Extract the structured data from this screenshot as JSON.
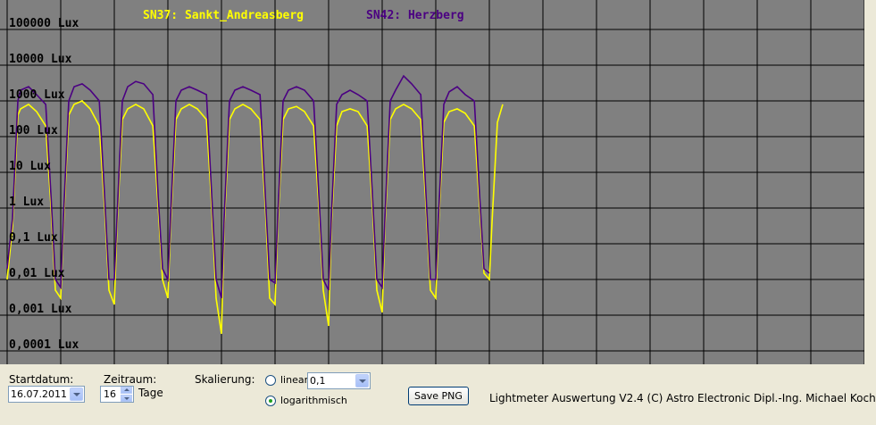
{
  "chart_data": {
    "type": "line",
    "title": "",
    "xlabel": "",
    "ylabel": "",
    "y_scale": "log",
    "ylim": [
      0.0001,
      100000
    ],
    "xlim": [
      0,
      16
    ],
    "x_unit": "days from 16.07.2011",
    "grid": true,
    "y_tick_labels": [
      "100000 Lux",
      "10000 Lux",
      "1000 Lux",
      "100 Lux",
      "10 Lux",
      "1 Lux",
      "0,1 Lux",
      "0,01 Lux",
      "0,001 Lux",
      "0,0001 Lux"
    ],
    "series": [
      {
        "name": "SN37: Sankt_Andreasberg",
        "color": "#ffff00",
        "x": [
          0.0,
          0.1,
          0.2,
          0.25,
          0.4,
          0.55,
          0.72,
          0.82,
          0.9,
          1.0,
          1.05,
          1.15,
          1.25,
          1.4,
          1.55,
          1.72,
          1.82,
          1.9,
          2.0,
          2.05,
          2.15,
          2.25,
          2.4,
          2.55,
          2.72,
          2.82,
          2.9,
          3.0,
          3.05,
          3.15,
          3.25,
          3.4,
          3.55,
          3.72,
          3.82,
          3.9,
          4.0,
          4.05,
          4.15,
          4.25,
          4.4,
          4.55,
          4.72,
          4.82,
          4.9,
          5.0,
          5.05,
          5.15,
          5.25,
          5.4,
          5.55,
          5.72,
          5.82,
          5.9,
          6.0,
          6.05,
          6.15,
          6.25,
          6.4,
          6.55,
          6.72,
          6.82,
          6.9,
          7.0,
          7.05,
          7.15,
          7.25,
          7.4,
          7.55,
          7.72,
          7.82,
          7.9,
          8.0,
          8.05,
          8.15,
          8.25,
          8.4,
          8.55,
          8.72,
          8.82,
          8.9,
          9.0,
          9.05,
          9.15,
          9.25
        ],
        "y": [
          0.01,
          0.3,
          400,
          600,
          800,
          500,
          200,
          1,
          0.005,
          0.003,
          0.3,
          400,
          800,
          1000,
          600,
          200,
          1,
          0.005,
          0.002,
          0.3,
          300,
          600,
          800,
          600,
          200,
          1,
          0.01,
          0.003,
          0.3,
          300,
          600,
          800,
          600,
          300,
          1,
          0.003,
          0.0003,
          0.3,
          300,
          600,
          800,
          600,
          300,
          1,
          0.003,
          0.002,
          0.3,
          300,
          600,
          700,
          500,
          200,
          1,
          0.005,
          0.0005,
          0.3,
          200,
          500,
          600,
          500,
          200,
          1,
          0.005,
          0.0012,
          0.3,
          300,
          600,
          800,
          600,
          300,
          1,
          0.005,
          0.003,
          0.3,
          250,
          500,
          600,
          450,
          200,
          1,
          0.015,
          0.01,
          0.4,
          250,
          800
        ]
      },
      {
        "name": "SN42: Herzberg",
        "color": "#4b0082",
        "x": [
          0.0,
          0.1,
          0.2,
          0.25,
          0.4,
          0.55,
          0.72,
          0.82,
          0.9,
          1.0,
          1.05,
          1.15,
          1.25,
          1.4,
          1.55,
          1.72,
          1.82,
          1.9,
          2.0,
          2.05,
          2.15,
          2.25,
          2.4,
          2.55,
          2.72,
          2.82,
          2.9,
          3.0,
          3.05,
          3.15,
          3.25,
          3.4,
          3.55,
          3.72,
          3.82,
          3.9,
          4.0,
          4.05,
          4.15,
          4.25,
          4.4,
          4.55,
          4.72,
          4.82,
          4.9,
          5.0,
          5.05,
          5.15,
          5.25,
          5.4,
          5.55,
          5.72,
          5.82,
          5.9,
          6.0,
          6.05,
          6.15,
          6.25,
          6.4,
          6.55,
          6.72,
          6.82,
          6.9,
          7.0,
          7.05,
          7.15,
          7.25,
          7.4,
          7.55,
          7.72,
          7.82,
          7.9,
          8.0,
          8.05,
          8.15,
          8.25,
          8.4,
          8.55,
          8.72,
          8.82,
          8.9,
          9.0
        ],
        "y": [
          0.02,
          0.5,
          1000,
          2000,
          2500,
          1500,
          800,
          2,
          0.01,
          0.006,
          0.5,
          1000,
          2500,
          3000,
          2000,
          1000,
          2,
          0.01,
          0.01,
          0.5,
          1000,
          2500,
          3500,
          3000,
          1500,
          2,
          0.02,
          0.01,
          0.5,
          1000,
          2000,
          2500,
          2000,
          1500,
          2,
          0.01,
          0.003,
          0.5,
          1000,
          2000,
          2500,
          2000,
          1500,
          2,
          0.01,
          0.008,
          0.5,
          1000,
          2000,
          2500,
          2000,
          1000,
          2,
          0.01,
          0.005,
          0.5,
          800,
          1500,
          2000,
          1500,
          1000,
          2,
          0.01,
          0.006,
          0.5,
          1000,
          2000,
          5000,
          3000,
          1500,
          2,
          0.01,
          0.01,
          0.5,
          800,
          1800,
          2500,
          1500,
          1000,
          2,
          0.02,
          0.015
        ]
      }
    ]
  },
  "controls": {
    "startdatum_label": "Startdatum:",
    "startdatum_value": "16.07.2011",
    "zeitraum_label": "Zeitraum:",
    "zeitraum_value": "16",
    "tage_label": "Tage",
    "skalierung_label": "Skalierung:",
    "linear_label": "linear",
    "linear_value": "0,1",
    "log_label": "logarithmisch",
    "scale_selected": "logarithmisch",
    "save_button": "Save PNG",
    "footer_text": "Lightmeter Auswertung V2.4  (C) Astro Electronic Dipl.-Ing. Michael Koch"
  }
}
